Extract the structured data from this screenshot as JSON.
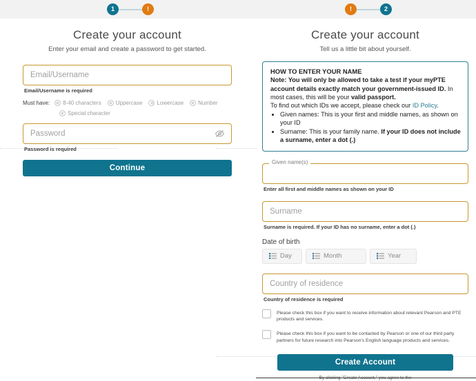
{
  "stepper_left": {
    "steps": [
      {
        "label": "1",
        "state": "active",
        "icon": "step-number-icon"
      },
      {
        "label": "!",
        "state": "warning",
        "icon": "step-alert-icon"
      }
    ]
  },
  "stepper_right": {
    "steps": [
      {
        "label": "!",
        "state": "warning",
        "icon": "step-alert-icon"
      },
      {
        "label": "2",
        "state": "active",
        "icon": "step-number-icon"
      }
    ]
  },
  "left_panel": {
    "title": "Create your account",
    "subtitle": "Enter your email and create a password to get started.",
    "email": {
      "placeholder": "Email/Username",
      "value": "",
      "error": "Email/Username is required"
    },
    "must_have": {
      "label": "Must have:",
      "rules": [
        "8-40 characters",
        "Uppercase",
        "Lowercase",
        "Number",
        "Special character"
      ]
    },
    "password": {
      "placeholder": "Password",
      "value": "",
      "error": "Password is required",
      "toggle_icon": "eye-slash-icon"
    },
    "continue_label": "Continue"
  },
  "right_panel": {
    "title": "Create your account",
    "subtitle": "Tell us a little bit about yourself.",
    "info_box": {
      "title": "HOW TO ENTER YOUR NAME",
      "note_prefix": "Note: You will only be allowed to take a test if your myPTE account details exactly match your government-issued ID.",
      "note_middle": " In most cases, this will be your ",
      "note_bold": "valid passport.",
      "policy_prefix": "To find out which IDs we accept, please check our ",
      "policy_link": "ID Policy",
      "policy_suffix": ".",
      "bullet1_bold": "Given names:",
      "bullet1_text": " This is your first and middle names, as shown on your ID",
      "bullet2_bold": "Surname:",
      "bullet2_text": " This is your family name. ",
      "bullet2_bold2": "If your ID does not include a surname, enter a dot (.)"
    },
    "given_names": {
      "label": "Given name(s)",
      "value": "",
      "helper": "Enter all first and middle names as shown on your ID"
    },
    "surname": {
      "placeholder": "Surname",
      "value": "",
      "helper": "Surname is required. If your ID has no surname, enter a dot (.)"
    },
    "date_of_birth": {
      "label": "Date of birth",
      "day": "Day",
      "month": "Month",
      "year": "Year",
      "icon": "list-icon"
    },
    "country": {
      "placeholder": "Country of residence",
      "value": "",
      "helper": "Country of residence is required"
    },
    "consents": [
      "Please check this box if you want to receive information about relevant Pearson and PTE products and services.",
      "Please check this box if you want to be contacted by Pearson or one of our third party partners for future research into Pearson's English language products and services."
    ],
    "create_account_label": "Create Account",
    "agreement_text": "By clicking \"Create Account,\" you agree to the"
  },
  "colors": {
    "teal": "#10748f",
    "orange": "#e07b12",
    "field_border": "#c9972f",
    "info_border": "#2e7e90",
    "band": "#f2f2f2"
  }
}
